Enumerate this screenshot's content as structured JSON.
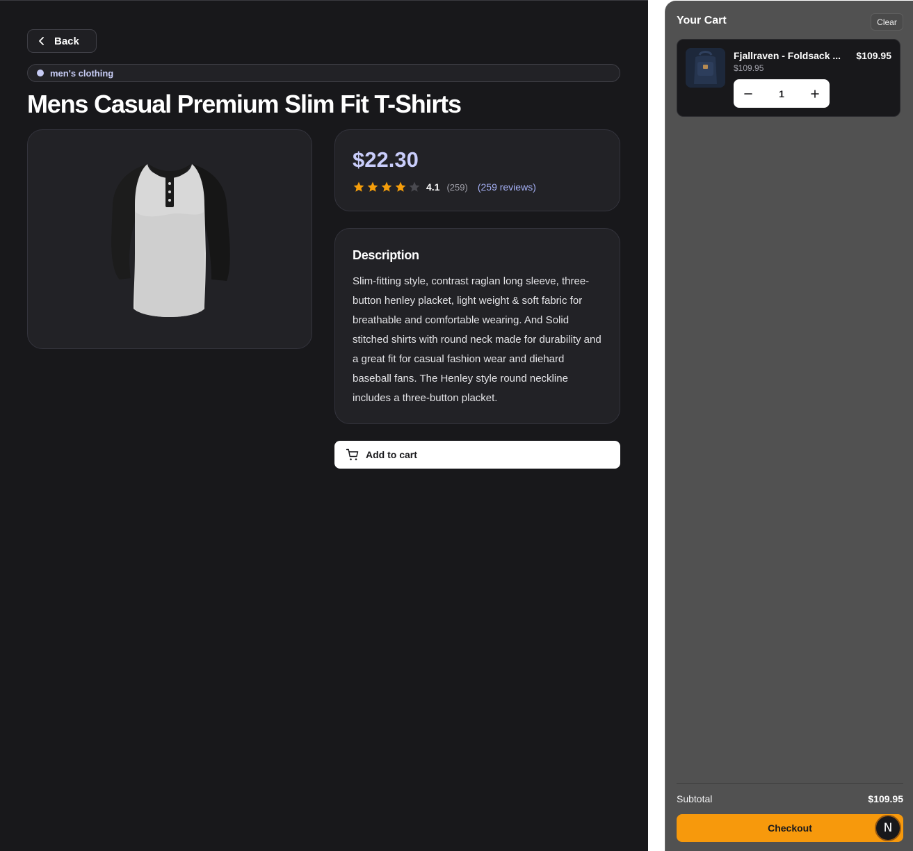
{
  "nav": {
    "back_label": "Back"
  },
  "product": {
    "category": "men's clothing",
    "title": "Mens Casual Premium Slim Fit T-Shirts",
    "price": "$22.30",
    "rating": {
      "value": "4.1",
      "count": "(259)",
      "reviews_link": "(259 reviews)",
      "stars_filled": 4,
      "stars_total": 5
    },
    "description_heading": "Description",
    "description": "Slim-fitting style, contrast raglan long sleeve, three-button henley placket, light weight & soft fabric for breathable and comfortable wearing. And Solid stitched shirts with round neck made for durability and a great fit for casual fashion wear and diehard baseball fans. The Henley style round neckline includes a three-button placket.",
    "add_to_cart_label": "Add to cart",
    "image_icon": "tshirt-image"
  },
  "cart": {
    "title": "Your Cart",
    "clear_label": "Clear",
    "items": [
      {
        "name": "Fjallraven - Foldsack ...",
        "unit_price": "$109.95",
        "line_total": "$109.95",
        "quantity": "1",
        "image_icon": "backpack-image"
      }
    ],
    "subtotal_label": "Subtotal",
    "subtotal_value": "$109.95",
    "checkout_label": "Checkout",
    "avatar_initial": "N"
  },
  "colors": {
    "accent_price": "#c9cdfa",
    "star": "#f59e0b",
    "checkout": "#f7990c",
    "link": "#a5b0f5"
  }
}
